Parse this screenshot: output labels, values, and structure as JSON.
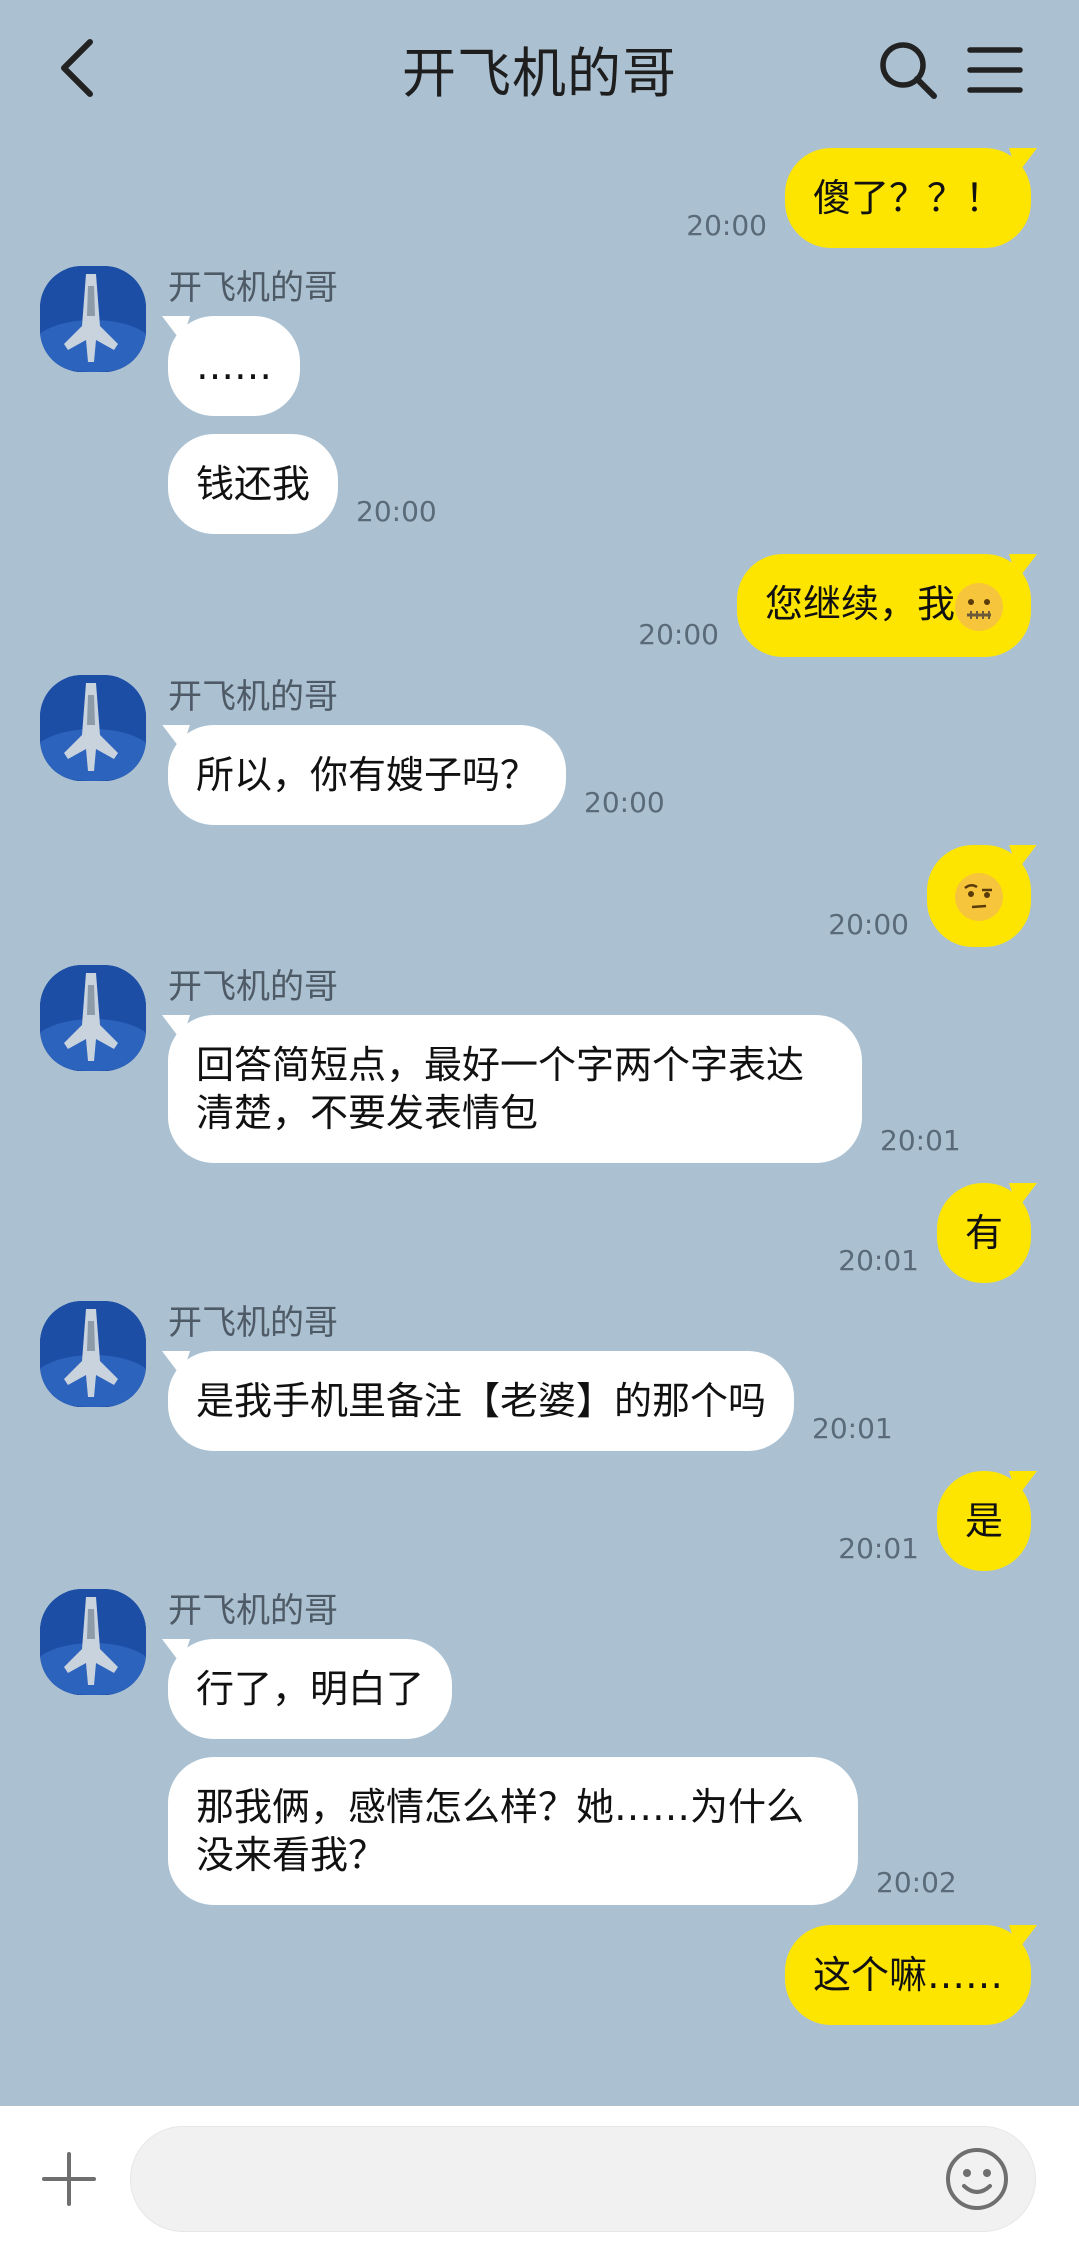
{
  "header": {
    "title": "开飞机的哥"
  },
  "contact": {
    "name": "开飞机的哥"
  },
  "messages": {
    "m1": {
      "text": "傻了？？！",
      "time": "20:00"
    },
    "m2a": {
      "text": "……"
    },
    "m2b": {
      "text": "钱还我",
      "time": "20:00"
    },
    "m3": {
      "text": "您继续，我",
      "time": "20:00"
    },
    "m4": {
      "text": "所以，你有嫂子吗？",
      "time": "20:00"
    },
    "m5": {
      "time": "20:00"
    },
    "m6": {
      "text": "回答简短点，最好一个字两个字表达清楚，不要发表情包",
      "time": "20:01"
    },
    "m7": {
      "text": "有",
      "time": "20:01"
    },
    "m8": {
      "text": "是我手机里备注【老婆】的那个吗",
      "time": "20:01"
    },
    "m9": {
      "text": "是",
      "time": "20:01"
    },
    "m10a": {
      "text": "行了，明白了"
    },
    "m10b": {
      "text": "那我俩，感情怎么样？她……为什么没来看我？",
      "time": "20:02"
    },
    "m11": {
      "text": "这个嘛……"
    }
  },
  "icons": {
    "back": "chevron-left-icon",
    "search": "search-icon",
    "menu": "hamburger-menu-icon",
    "plus": "plus-icon",
    "emoji": "smiley-icon",
    "zipper_mouth": "zipper-mouth-emoji",
    "raised_eyebrow": "raised-eyebrow-emoji"
  },
  "colors": {
    "background": "#abc1d1",
    "outgoing_bubble": "#fee500",
    "incoming_bubble": "#ffffff"
  }
}
